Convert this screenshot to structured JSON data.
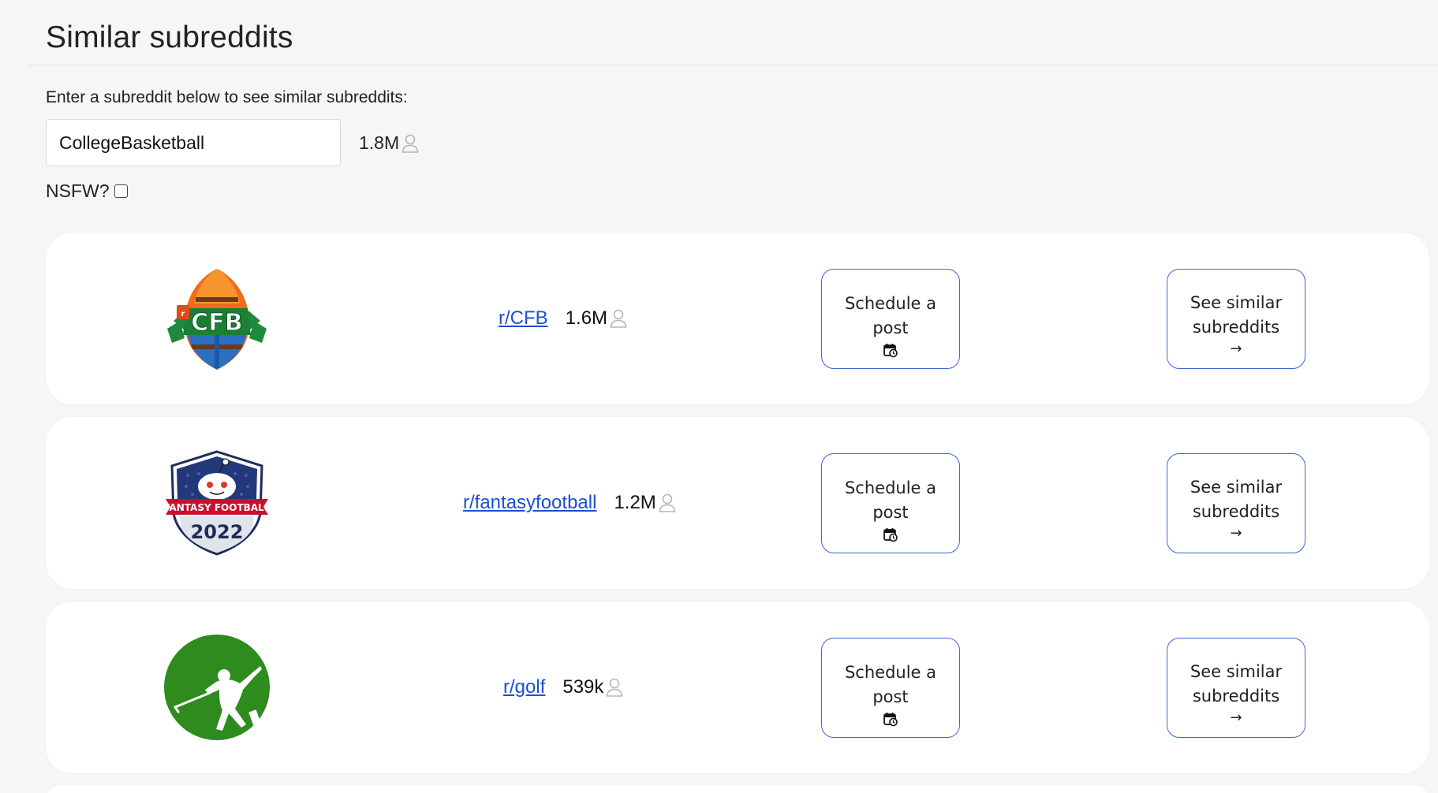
{
  "header": {
    "title": "Similar subreddits"
  },
  "search": {
    "instructions": "Enter a subreddit below to see similar subreddits:",
    "value": "CollegeBasketball",
    "member_count": "1.8M",
    "nsfw_label": "NSFW?",
    "nsfw_checked": false
  },
  "results": [
    {
      "name": "r/CFB",
      "members": "1.6M",
      "logo": "cfb-logo",
      "schedule_label": "Schedule a post",
      "schedule_icon": "calendar-clock-icon",
      "similar_label": "See similar subreddits",
      "similar_icon": "arrow-right-icon"
    },
    {
      "name": "r/fantasyfootball",
      "members": "1.2M",
      "logo": "fantasy-football-2022-logo",
      "logo_text_top": "FANTASY FOOTBALL",
      "logo_text_bottom": "2022",
      "schedule_label": "Schedule a post",
      "schedule_icon": "calendar-clock-icon",
      "similar_label": "See similar subreddits",
      "similar_icon": "arrow-right-icon"
    },
    {
      "name": "r/golf",
      "members": "539k",
      "logo": "golf-logo",
      "schedule_label": "Schedule a post",
      "schedule_icon": "calendar-clock-icon",
      "similar_label": "See similar subreddits",
      "similar_icon": "arrow-right-icon"
    }
  ],
  "colors": {
    "link": "#1a4fd6",
    "button_border": "#3f66d6",
    "page_background": "#f6f6f6",
    "card_background": "#ffffff",
    "golf_green": "#2e8b1e",
    "cfb_green": "#1f8a3b",
    "cfb_orange": "#f26b1d",
    "ff_navy": "#1c2c5b",
    "ff_red": "#c8102e"
  }
}
